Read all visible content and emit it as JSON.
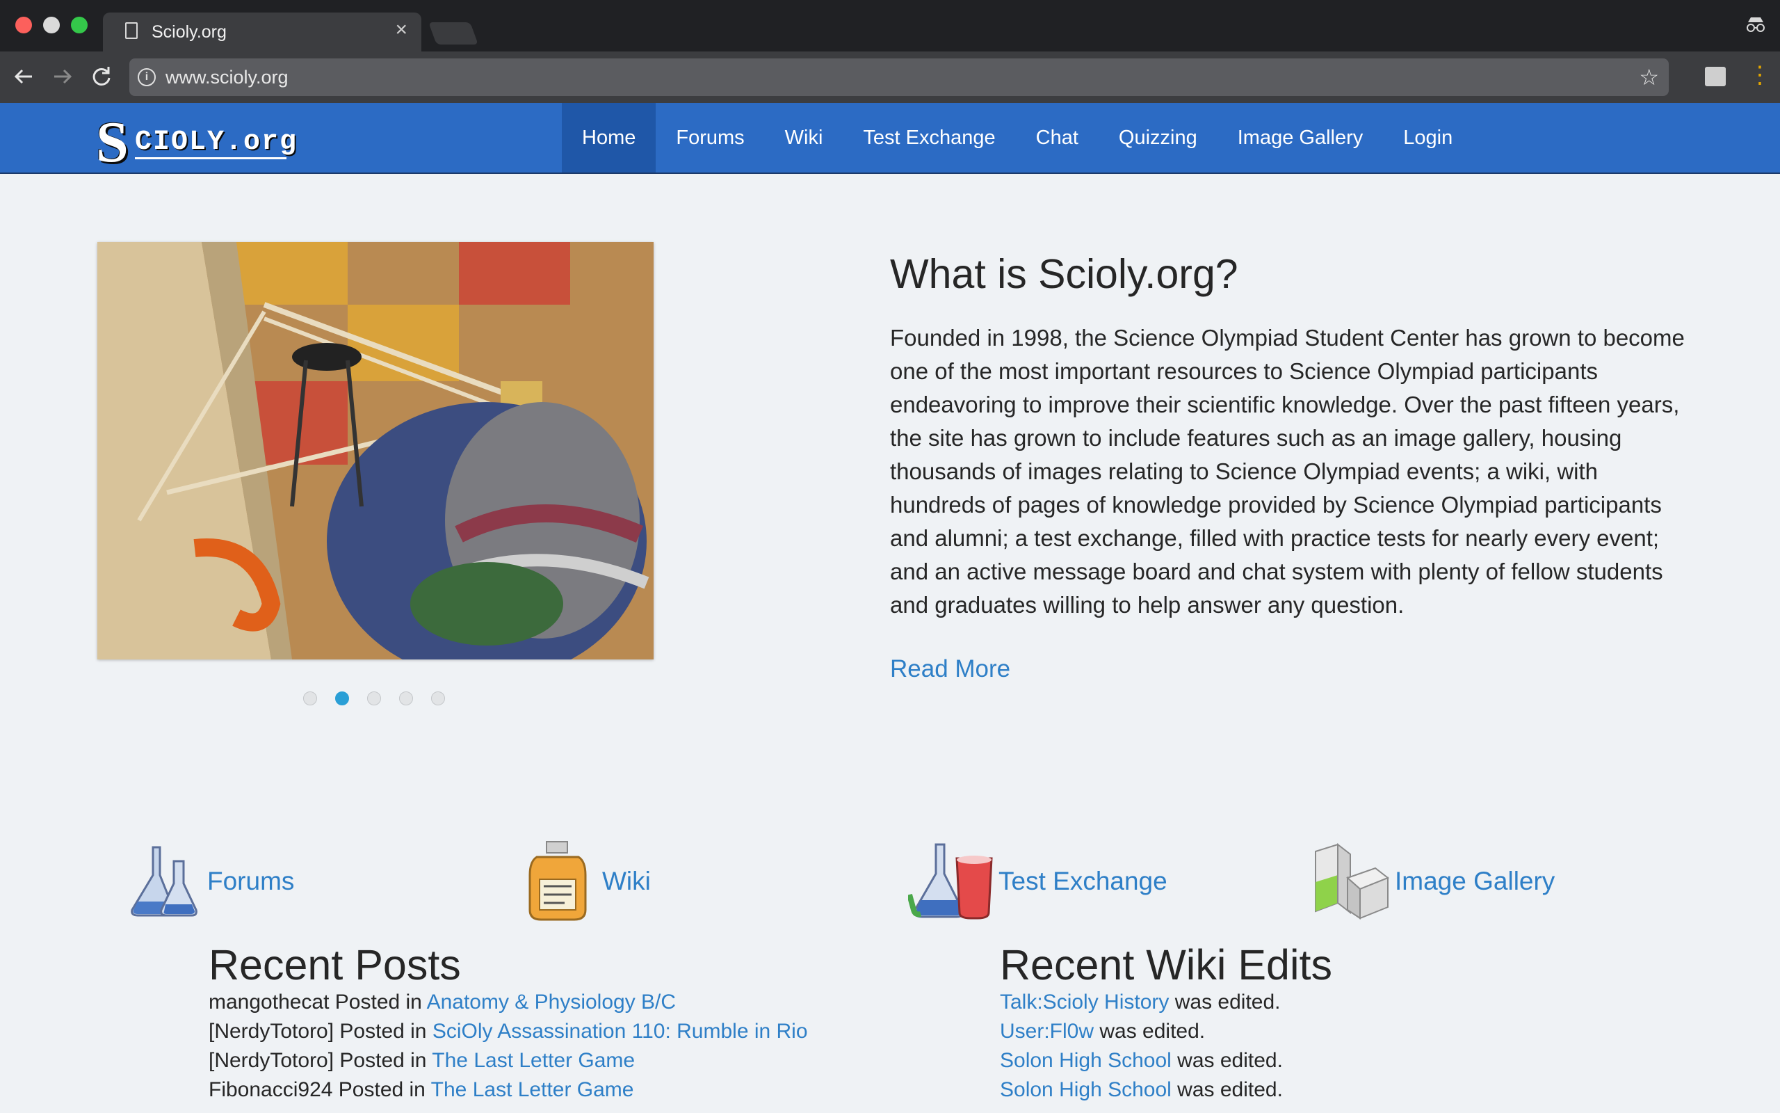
{
  "browser": {
    "tab_title": "Scioly.org",
    "tab_close": "×",
    "url": "www.scioly.org",
    "icons": {
      "back": "arrow-left-icon",
      "forward": "arrow-right-icon",
      "reload": "reload-icon",
      "info": "info-icon",
      "bookmark": "star-icon",
      "extension": "cast-icon",
      "menu": "kebab-menu-icon",
      "incognito": "incognito-icon"
    }
  },
  "site": {
    "logo": {
      "initial": "S",
      "rest": "CIOLY.org"
    },
    "nav": [
      {
        "label": "Home",
        "active": true
      },
      {
        "label": "Forums"
      },
      {
        "label": "Wiki"
      },
      {
        "label": "Test Exchange"
      },
      {
        "label": "Chat"
      },
      {
        "label": "Quizzing"
      },
      {
        "label": "Image Gallery"
      },
      {
        "label": "Login"
      }
    ],
    "colors": {
      "navbar": "#2c6bc4",
      "nav_active": "#1f57a8",
      "link": "#2e7fc7",
      "dot_active": "#2a9fd6"
    }
  },
  "hero": {
    "carousel_slides": 5,
    "carousel_active_slide": 2,
    "title": "What is Scioly.org?",
    "body": "Founded in 1998, the Science Olympiad Student Center has grown to become one of the most important resources to Science Olympiad participants endeavoring to improve their scientific knowledge. Over the past fifteen years, the site has grown to include features such as an image gallery, housing thousands of images relating to Science Olympiad events; a wiki, with hundreds of pages of knowledge provided by Science Olympiad participants and alumni; a test exchange, filled with practice tests for nearly every event; and an active message board and chat system with plenty of fellow students and graduates willing to help answer any question.",
    "read_more": "Read More"
  },
  "features": [
    {
      "label": "Forums",
      "icon": "flasks-icon"
    },
    {
      "label": "Wiki",
      "icon": "jar-icon"
    },
    {
      "label": "Test Exchange",
      "icon": "flask-beaker-icon"
    },
    {
      "label": "Image Gallery",
      "icon": "gallery-boxes-icon"
    }
  ],
  "recent_posts": {
    "title": "Recent Posts",
    "items": [
      {
        "user": "mangothecat",
        "posted_in": " Posted in ",
        "topic": "Anatomy & Physiology B/C"
      },
      {
        "user": "[NerdyTotoro]",
        "posted_in": " Posted in ",
        "topic": "SciOly Assassination 110: Rumble in Rio"
      },
      {
        "user": "[NerdyTotoro]",
        "posted_in": " Posted in ",
        "topic": "The Last Letter Game"
      },
      {
        "user": "Fibonacci924",
        "posted_in": " Posted in ",
        "topic": "The Last Letter Game"
      }
    ]
  },
  "recent_wiki": {
    "title": "Recent Wiki Edits",
    "items": [
      {
        "page": "Talk:Scioly History",
        "suffix": " was edited."
      },
      {
        "page": "User:Fl0w",
        "suffix": " was edited."
      },
      {
        "page": "Solon High School",
        "suffix": " was edited."
      },
      {
        "page": "Solon High School",
        "suffix": " was edited."
      }
    ]
  }
}
